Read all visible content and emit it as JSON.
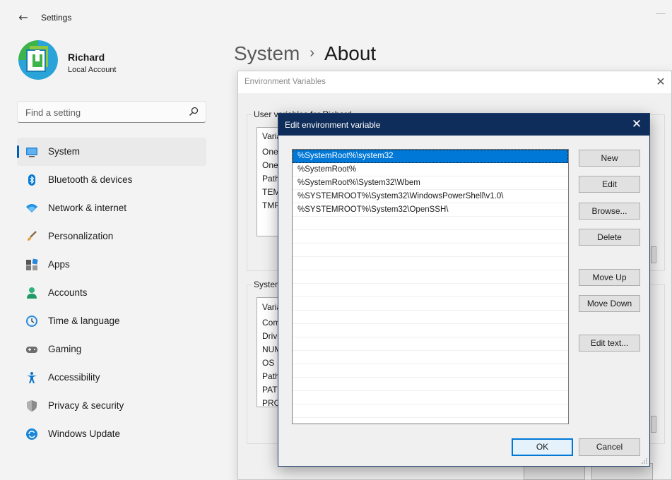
{
  "app": {
    "title": "Settings",
    "back_icon": "back-arrow-icon"
  },
  "user": {
    "name": "Richard",
    "account_type": "Local Account"
  },
  "search": {
    "placeholder": "Find a setting"
  },
  "nav": {
    "items": [
      {
        "label": "System",
        "icon": "system-icon",
        "active": true
      },
      {
        "label": "Bluetooth & devices",
        "icon": "bluetooth-icon"
      },
      {
        "label": "Network & internet",
        "icon": "network-icon"
      },
      {
        "label": "Personalization",
        "icon": "brush-icon"
      },
      {
        "label": "Apps",
        "icon": "apps-icon"
      },
      {
        "label": "Accounts",
        "icon": "accounts-icon"
      },
      {
        "label": "Time & language",
        "icon": "clock-icon"
      },
      {
        "label": "Gaming",
        "icon": "gamepad-icon"
      },
      {
        "label": "Accessibility",
        "icon": "accessibility-icon"
      },
      {
        "label": "Privacy & security",
        "icon": "shield-icon"
      },
      {
        "label": "Windows Update",
        "icon": "update-icon"
      }
    ]
  },
  "breadcrumb": {
    "parent": "System",
    "separator": "›",
    "current": "About"
  },
  "env_dialog": {
    "title": "Environment Variables",
    "user_group_label": "User variables for Richard",
    "user_list": {
      "header": "Varia",
      "rows": [
        "One",
        "One",
        "Path",
        "TEM",
        "TMP"
      ]
    },
    "system_group_label": "System",
    "system_list": {
      "header": "Varia",
      "rows": [
        "Com",
        "Drive",
        "NUM",
        "OS",
        "Path",
        "PATH",
        "PRO"
      ]
    }
  },
  "edit_dialog": {
    "title": "Edit environment variable",
    "entries": [
      "%SystemRoot%\\system32",
      "%SystemRoot%",
      "%SystemRoot%\\System32\\Wbem",
      "%SYSTEMROOT%\\System32\\WindowsPowerShell\\v1.0\\",
      "%SYSTEMROOT%\\System32\\OpenSSH\\"
    ],
    "selected_index": 0,
    "buttons": {
      "new": "New",
      "edit": "Edit",
      "browse": "Browse...",
      "delete": "Delete",
      "move_up": "Move Up",
      "move_down": "Move Down",
      "edit_text": "Edit text..."
    },
    "ok": "OK",
    "cancel": "Cancel"
  },
  "colors": {
    "accent": "#005fb8",
    "selection": "#0078d7",
    "dialog_title": "#0f2d5a"
  }
}
